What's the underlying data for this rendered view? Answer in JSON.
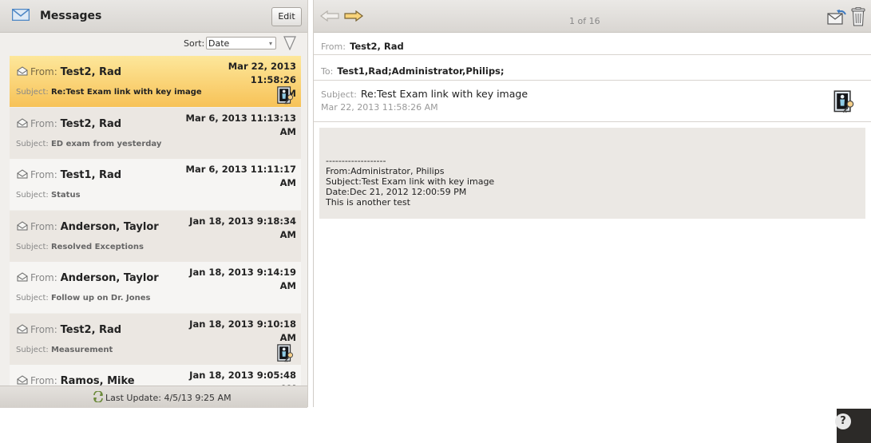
{
  "left": {
    "title": "Messages",
    "edit_label": "Edit",
    "sort_label": "Sort:",
    "sort_value": "Date",
    "last_update": "Last Update: 4/5/13 9:25 AM",
    "from_label": "From:",
    "subject_label": "Subject:",
    "messages": [
      {
        "from": "Test2, Rad",
        "date_line1": "Mar 22, 2013 11:58:26",
        "date_line2": "AM",
        "subject": "Re:Test Exam link with key image",
        "selected": true,
        "has_key_image": true
      },
      {
        "from": "Test2, Rad",
        "date_line1": "Mar 6, 2013 11:13:13",
        "date_line2": "AM",
        "subject": "ED exam from yesterday",
        "selected": false,
        "has_key_image": false
      },
      {
        "from": "Test1, Rad",
        "date_line1": "Mar 6, 2013 11:11:17",
        "date_line2": "AM",
        "subject": "Status",
        "selected": false,
        "has_key_image": false
      },
      {
        "from": "Anderson, Taylor",
        "date_line1": "Jan 18, 2013 9:18:34",
        "date_line2": "AM",
        "subject": "Resolved Exceptions",
        "selected": false,
        "has_key_image": false
      },
      {
        "from": "Anderson, Taylor",
        "date_line1": "Jan 18, 2013 9:14:19",
        "date_line2": "AM",
        "subject": "Follow up on Dr. Jones",
        "selected": false,
        "has_key_image": false
      },
      {
        "from": "Test2, Rad",
        "date_line1": "Jan 18, 2013 9:10:18",
        "date_line2": "AM",
        "subject": "Measurement",
        "selected": false,
        "has_key_image": true
      },
      {
        "from": "Ramos, Mike",
        "date_line1": "Jan 18, 2013 9:05:48",
        "date_line2": "AM",
        "subject": "",
        "selected": false,
        "has_key_image": false
      }
    ]
  },
  "right": {
    "page_indicator": "1 of 16",
    "from_label": "From:",
    "from_value": "Test2, Rad",
    "to_label": "To:",
    "to_value": "Test1,Rad;Administrator,Philips;",
    "subject_label": "Subject:",
    "subject_value": "Re:Test Exam link with key image",
    "date": "Mar 22, 2013 11:58:26 AM",
    "body": {
      "separator": "-------------------",
      "from_line": "From:Administrator, Philips",
      "subject_line": "Subject:Test Exam link with key image",
      "date_line": "Date:Dec 21, 2012 12:00:59 PM",
      "text_line": "This is another test"
    }
  },
  "help_label": "?",
  "colors": {
    "selected_row": "#f7c257",
    "pane_bg": "#f1efec",
    "body_bg": "#ebe8e4"
  }
}
